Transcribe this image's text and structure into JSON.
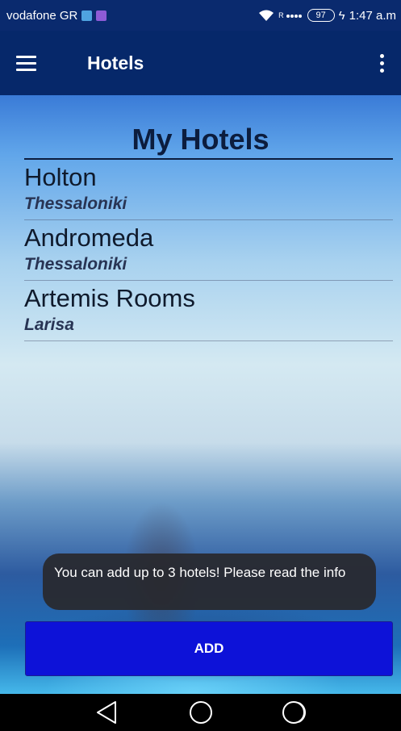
{
  "status_bar": {
    "carrier": "vodafone GR",
    "signal_info": "R",
    "battery": "97",
    "time": "1:47 a.m"
  },
  "app_bar": {
    "title": "Hotels"
  },
  "main": {
    "heading": "My Hotels",
    "hotels": [
      {
        "name": "Holton",
        "city": "Thessaloniki"
      },
      {
        "name": "Andromeda",
        "city": "Thessaloniki"
      },
      {
        "name": "Artemis Rooms",
        "city": "Larisa"
      }
    ],
    "toast": "You can add up to 3 hotels! Please read the info",
    "add_button": "ADD"
  },
  "colors": {
    "app_bar": "#06286a",
    "heading_text": "#0c1d3e",
    "add_button": "#0d12d8",
    "toast_bg": "#28282c"
  },
  "icons": {
    "menu": "hamburger-menu-icon",
    "more": "more-vert-icon",
    "nav": [
      "back-triangle-icon",
      "home-circle-icon",
      "recents-icon"
    ]
  }
}
